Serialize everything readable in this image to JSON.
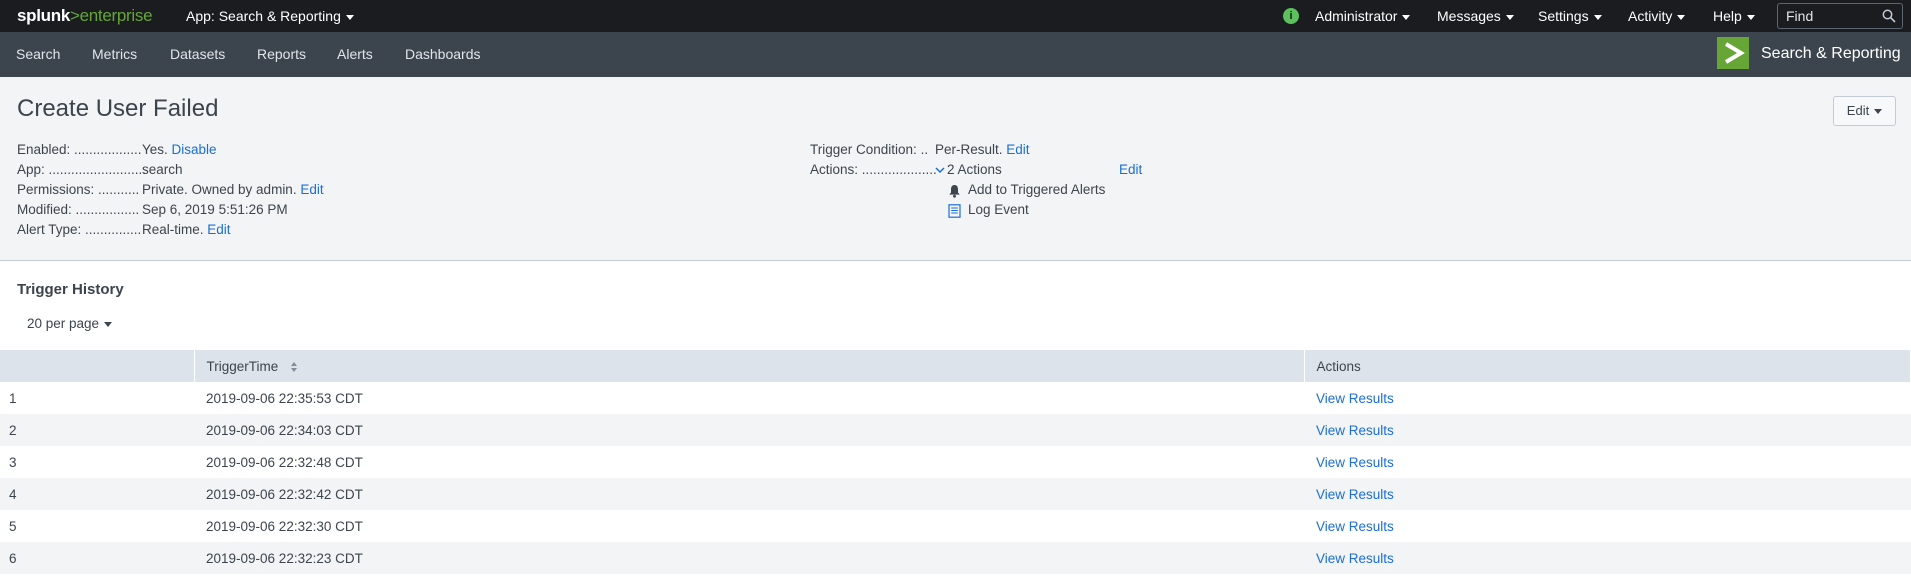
{
  "topbar": {
    "logo_part1": "splunk",
    "logo_part2": ">enterprise",
    "app_menu": "App: Search & Reporting",
    "user": "Administrator",
    "messages": "Messages",
    "settings": "Settings",
    "activity": "Activity",
    "help": "Help",
    "find_placeholder": "Find",
    "info_icon": "i"
  },
  "appbar": {
    "nav": [
      "Search",
      "Metrics",
      "Datasets",
      "Reports",
      "Alerts",
      "Dashboards"
    ],
    "app_title": "Search & Reporting"
  },
  "alert": {
    "title": "Create User Failed",
    "edit_button": "Edit",
    "enabled_label": "Enabled:",
    "enabled_value": "Yes.",
    "enabled_action": "Disable",
    "app_label": "App:",
    "app_value": "search",
    "permissions_label": "Permissions:",
    "permissions_value": "Private. Owned by admin.",
    "permissions_action": "Edit",
    "modified_label": "Modified:",
    "modified_value": "Sep 6, 2019 5:51:26 PM",
    "alert_type_label": "Alert Type:",
    "alert_type_value": "Real-time.",
    "alert_type_action": "Edit",
    "trigger_condition_label": "Trigger Condition:",
    "trigger_condition_value": "Per-Result.",
    "trigger_condition_action": "Edit",
    "actions_label": "Actions:",
    "actions_value": "2 Actions",
    "actions_edit": "Edit",
    "action_items": [
      "Add to Triggered Alerts",
      "Log Event"
    ]
  },
  "history": {
    "title": "Trigger History",
    "per_page": "20 per page",
    "columns": [
      "",
      "TriggerTime",
      "Actions"
    ],
    "rows": [
      {
        "n": "1",
        "time": "2019-09-06 22:35:53 CDT",
        "action": "View Results"
      },
      {
        "n": "2",
        "time": "2019-09-06 22:34:03 CDT",
        "action": "View Results"
      },
      {
        "n": "3",
        "time": "2019-09-06 22:32:48 CDT",
        "action": "View Results"
      },
      {
        "n": "4",
        "time": "2019-09-06 22:32:42 CDT",
        "action": "View Results"
      },
      {
        "n": "5",
        "time": "2019-09-06 22:32:30 CDT",
        "action": "View Results"
      },
      {
        "n": "6",
        "time": "2019-09-06 22:32:23 CDT",
        "action": "View Results"
      }
    ]
  },
  "colors": {
    "topbar_bg": "#1a1c20",
    "appbar_bg": "#3c444d",
    "accent_green": "#65a637",
    "link_blue": "#1a6ed8",
    "header_bg": "#f2f4f5",
    "table_header_bg": "#dde3ea"
  },
  "icons": {
    "info": "info-icon",
    "find": "search-icon",
    "app_logo": "chevron-right-icon",
    "sort": "sort-icon",
    "bell": "bell-icon",
    "log": "document-icon",
    "expand": "chevron-down-icon"
  }
}
